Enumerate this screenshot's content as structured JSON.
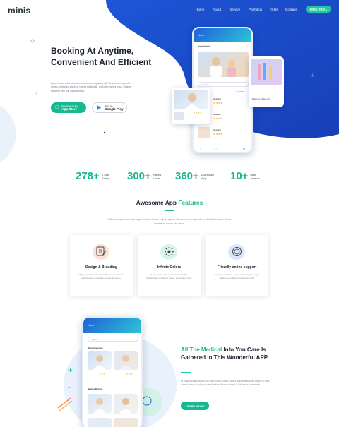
{
  "header": {
    "logo": "minis",
    "nav": [
      "Home",
      "About",
      "Service",
      "Portfolios",
      "FAQs",
      "Contact"
    ],
    "cta": "FREE TRIAL"
  },
  "hero": {
    "title": "Booking At Anytime, Convenient And Efficient",
    "description": "Lorem ipsum dolor sit amet, consectetur adipiscing elit. Vivamus a neque elit. Donec commodo, ipsum et viverra sollicitudin, libero leo viverra tellus, sit amet hendrerit nibh nisl volutpat tellus.",
    "app_store": {
      "small": "Download on the",
      "big": "App Store"
    },
    "google_play": {
      "small": "Get it on",
      "big": "Google Play"
    }
  },
  "phone_main": {
    "header_label": "Home",
    "section": "New Article",
    "search": "Search",
    "list_title": "Hospital",
    "list": [
      {
        "name": "Hospital",
        "role": "Dr."
      },
      {
        "name": "Hospital",
        "role": "Dr."
      },
      {
        "name": "Hospital",
        "role": "Dr."
      }
    ]
  },
  "phone_card_right": {
    "label": "Days for Check up"
  },
  "stats": [
    {
      "value": "278+",
      "label": "5 Star Rating"
    },
    {
      "value": "300+",
      "label": "Happy Users"
    },
    {
      "value": "360+",
      "label": "Download App"
    },
    {
      "value": "10+",
      "label": "Best Awards"
    }
  ],
  "features": {
    "title_plain": "Awesome App ",
    "title_highlight": "Features",
    "description": "Nulla consequat commodo augue sit amet finibus. In justo sapien, elementum nec imperdiet a, blandit vel massa. Donec fermentum mauris nec ipsum.",
    "items": [
      {
        "title": "Design & Branding",
        "desc": "Morbi eget tellus nisi. Phasellus nec leo sit tellus pellentesque fermentum integer ac venen."
      },
      {
        "title": "Infinite Colors",
        "desc": "Fusce pretium nisi ut mi tempus fringilla. Suspendisse a placerat metus, sed tempor nunc."
      },
      {
        "title": "Friendly online support",
        "desc": "Aliquam eros libero, malesuada at dapibus eget, dictum nec massa. Quisque eros elit."
      }
    ]
  },
  "medical": {
    "title_highlight": "All The Medical",
    "title_rest": " Info You Care Is Gathered In This Wonderful APP",
    "description": "Ut imperdiet accumsan nisi vitae mattis. Etiam viverra laoreet felis vitae tempor. Fusce cursus lorem in dolor posuere facilisis. Nunc sodales id ultrices leo venenatis.",
    "button": "LEARN MORE",
    "phone": {
      "header_label": "Home",
      "search": "Search",
      "section1": "Recommended",
      "section2": "Nearby Doctor"
    }
  },
  "colors": {
    "brand_blue": "#1f4fd0",
    "accent": "#17b890"
  }
}
